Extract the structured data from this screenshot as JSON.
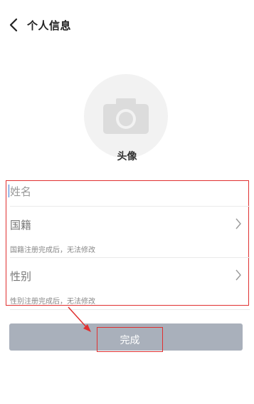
{
  "header": {
    "title": "个人信息",
    "back_icon": "chevron-left-icon"
  },
  "avatar": {
    "icon": "camera-icon",
    "label": "头像"
  },
  "form": {
    "name_placeholder": "姓名",
    "nationality_label": "国籍",
    "nationality_hint": "国籍注册完成后，无法修改",
    "gender_label": "性别",
    "gender_hint": "性别注册完成后，无法修改"
  },
  "submit": {
    "label": "完成"
  },
  "colors": {
    "highlight": "#e03030",
    "button": "#a9b0bb",
    "avatar_bg": "#f2f2f2"
  }
}
